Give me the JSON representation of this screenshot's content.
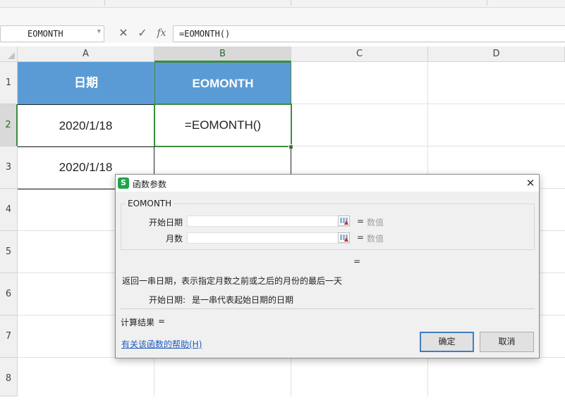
{
  "formula_bar": {
    "name_box": "EOMONTH",
    "cancel_icon": "✕",
    "enter_icon": "✓",
    "fx_label": "fx",
    "formula": "=EOMONTH()"
  },
  "columns": [
    "A",
    "B",
    "C",
    "D"
  ],
  "rows": [
    "1",
    "2",
    "3",
    "4",
    "5",
    "6",
    "7",
    "8"
  ],
  "cells": {
    "A1": "日期",
    "B1": "EOMONTH",
    "A2": "2020/1/18",
    "B2": "=EOMONTH()",
    "A3": "2020/1/18"
  },
  "colors": {
    "header_fill": "#5b9bd5",
    "selection": "#3c8c3c",
    "link": "#1f5bbf"
  },
  "dialog": {
    "icon_letter": "S",
    "title": "函数参数",
    "close_icon": "✕",
    "function_name": "EOMONTH",
    "args": [
      {
        "label": "开始日期",
        "value": "",
        "result": "数值"
      },
      {
        "label": "月数",
        "value": "",
        "result": "数值"
      }
    ],
    "eq": "=",
    "formula_result_eq": "=",
    "description": "返回一串日期，表示指定月数之前或之后的月份的最后一天",
    "param_desc_label": "开始日期:",
    "param_desc_text": "是一串代表起始日期的日期",
    "calc_result_label": "计算结果",
    "calc_result_eq": "=",
    "help_link": "有关该函数的帮助(H)",
    "ok_label": "确定",
    "cancel_label": "取消"
  }
}
